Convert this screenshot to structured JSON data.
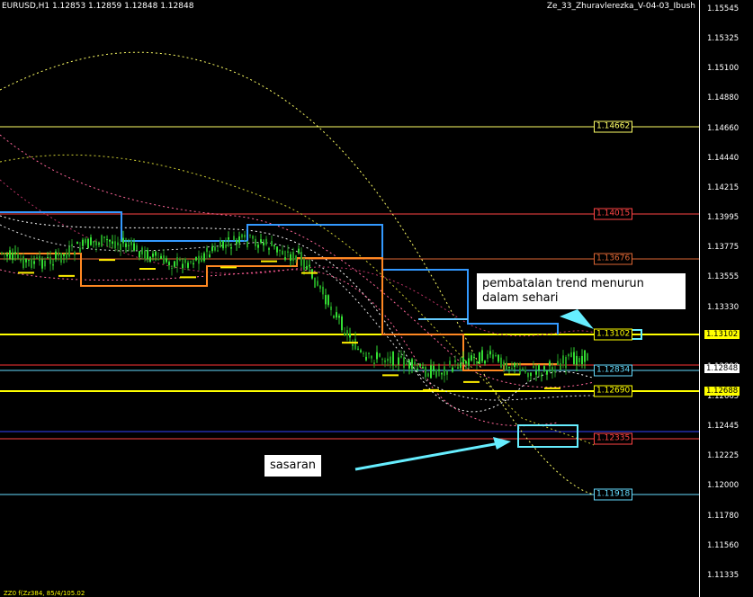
{
  "header": {
    "symbol_info": "EURUSD,H1  1.12853 1.12859 1.12848 1.12848",
    "indicator_name": "Ze_33_Zhuravlerezka_V-04-03_Ibush"
  },
  "price_axis": {
    "ticks": [
      "1.15545",
      "1.15325",
      "1.15100",
      "1.14880",
      "1.14660",
      "1.14440",
      "1.14215",
      "1.13995",
      "1.13775",
      "1.13555",
      "1.13330",
      "1.13110",
      "1.12890",
      "1.12665",
      "1.12445",
      "1.12225",
      "1.12000",
      "1.11780",
      "1.11560",
      "1.11335"
    ],
    "current_price": "1.12848",
    "level_1310": "1.13102",
    "level_1268": "1.12688"
  },
  "levels": [
    {
      "label": "1.14662",
      "color": "#ffff66"
    },
    {
      "label": "1.14015",
      "color": "#ff4444"
    },
    {
      "label": "1.13676",
      "color": "#dd6633"
    },
    {
      "label": "1.13102",
      "color": "#ffff00"
    },
    {
      "label": "1.12834",
      "color": "#66ddff"
    },
    {
      "label": "1.12690",
      "color": "#ffff00"
    },
    {
      "label": "1.12335",
      "color": "#ff4444"
    },
    {
      "label": "1.11918",
      "color": "#66ddff"
    }
  ],
  "annotations": {
    "cancel_trend": "pembatalan trend menurun dalam sehari",
    "target": "sasaran"
  },
  "footer": "ZZ0 f(Zz384, 85/4/105.02"
}
